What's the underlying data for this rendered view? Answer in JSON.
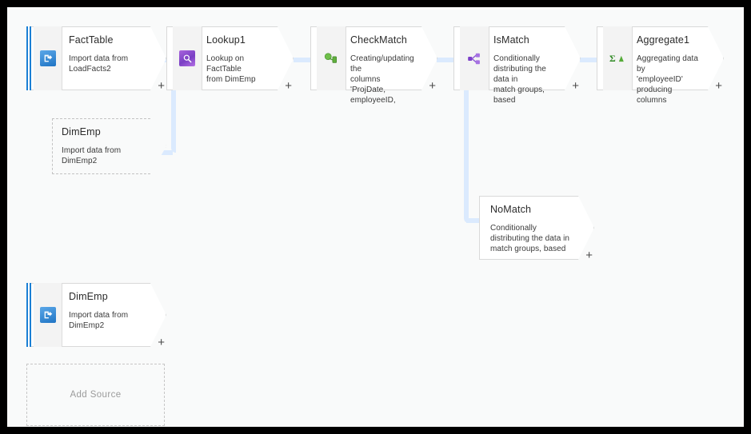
{
  "canvas": {
    "background_color": "#f9fafa",
    "connector_color": "#dbeafe",
    "frame_color": "#000000"
  },
  "nodes": [
    {
      "id": "FactTable",
      "kind": "source",
      "icon": "import-data-icon",
      "icon_color": "#1f74c4",
      "title": "FactTable",
      "description": "Import data from\nLoadFacts2",
      "plus_label": "+"
    },
    {
      "id": "DimEmpRef",
      "kind": "stream-reference",
      "icon": "none",
      "title": "DimEmp",
      "description": "Import data from\nDimEmp2",
      "plus_label": ""
    },
    {
      "id": "Lookup1",
      "kind": "transformation",
      "icon": "lookup-icon",
      "icon_color": "#8a49cf",
      "title": "Lookup1",
      "description": "Lookup on FactTable\nfrom DimEmp",
      "plus_label": "+"
    },
    {
      "id": "CheckMatch",
      "kind": "transformation",
      "icon": "derived-column-icon",
      "icon_color": "#57a63a",
      "title": "CheckMatch",
      "description": "Creating/updating the\ncolumns 'ProjDate,\nemployeeID,",
      "plus_label": "+"
    },
    {
      "id": "IsMatch",
      "kind": "transformation",
      "icon": "conditional-split-icon",
      "icon_color": "#8a49cf",
      "title": "IsMatch",
      "description": "Conditionally\ndistributing the data in\nmatch groups, based",
      "plus_label": "+"
    },
    {
      "id": "Aggregate1",
      "kind": "transformation",
      "icon": "aggregate-sigma-icon",
      "icon_color": "#3f9a2f",
      "title": "Aggregate1",
      "description": "Aggregating data by\n'employeeID'\nproducing columns",
      "plus_label": "+"
    },
    {
      "id": "NoMatch",
      "kind": "transformation-branch",
      "icon": "none",
      "title": "NoMatch",
      "description": "Conditionally\ndistributing the data in\nmatch groups, based",
      "plus_label": "+"
    },
    {
      "id": "DimEmpSource",
      "kind": "source",
      "icon": "import-data-icon",
      "icon_color": "#1f74c4",
      "title": "DimEmp",
      "description": "Import data from\nDimEmp2",
      "plus_label": "+"
    }
  ],
  "add_source": {
    "label": "Add Source"
  }
}
